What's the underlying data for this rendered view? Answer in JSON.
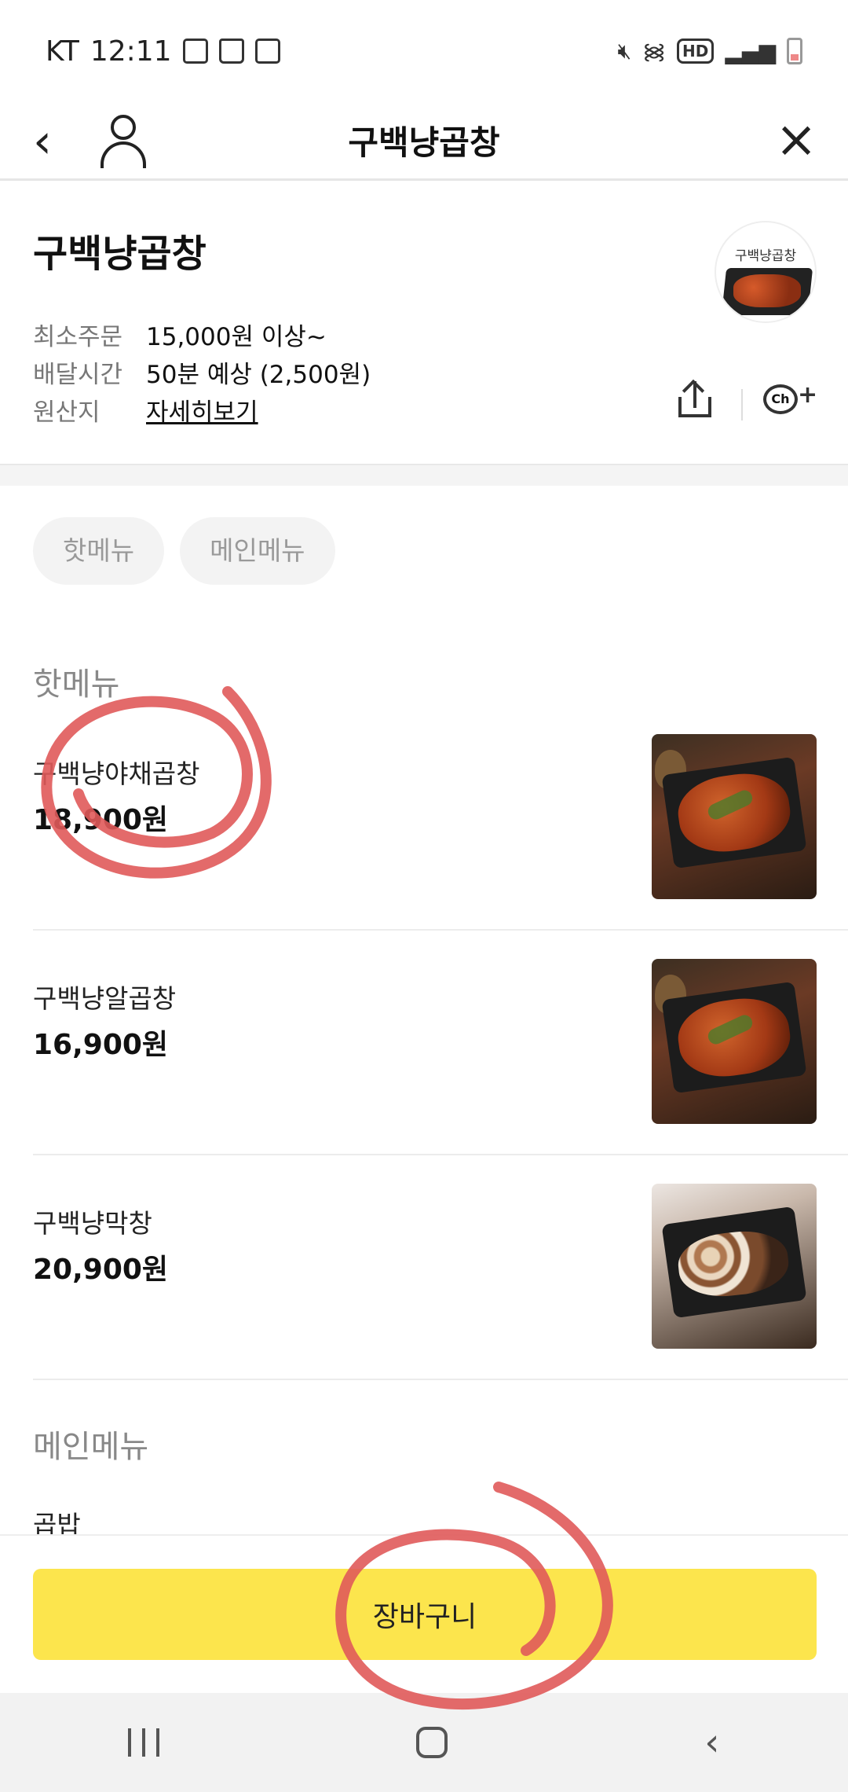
{
  "status_bar": {
    "carrier": "KT",
    "time": "12:11",
    "hd": "HD"
  },
  "header": {
    "title": "구백냥곱창"
  },
  "store": {
    "name": "구백냥곱창",
    "logo_text": "구백냥곱창",
    "info": [
      {
        "label": "최소주문",
        "value": "15,000원 이상~"
      },
      {
        "label": "배달시간",
        "value": "50분 예상 (2,500원)"
      },
      {
        "label": "원산지",
        "value": "자세히보기"
      }
    ],
    "ch_label": "Ch"
  },
  "tabs": [
    "핫메뉴",
    "메인메뉴"
  ],
  "sections": {
    "hot": {
      "title": "핫메뉴",
      "items": [
        {
          "name": "구백냥야채곱창",
          "price": "18,900원"
        },
        {
          "name": "구백냥알곱창",
          "price": "16,900원"
        },
        {
          "name": "구백냥막창",
          "price": "20,900원"
        }
      ]
    },
    "main": {
      "title": "메인메뉴",
      "first_item": "곱밥"
    }
  },
  "cart_button": {
    "label": "장바구니",
    "color": "#fce54d"
  },
  "annotation_color": "#e05a5a"
}
